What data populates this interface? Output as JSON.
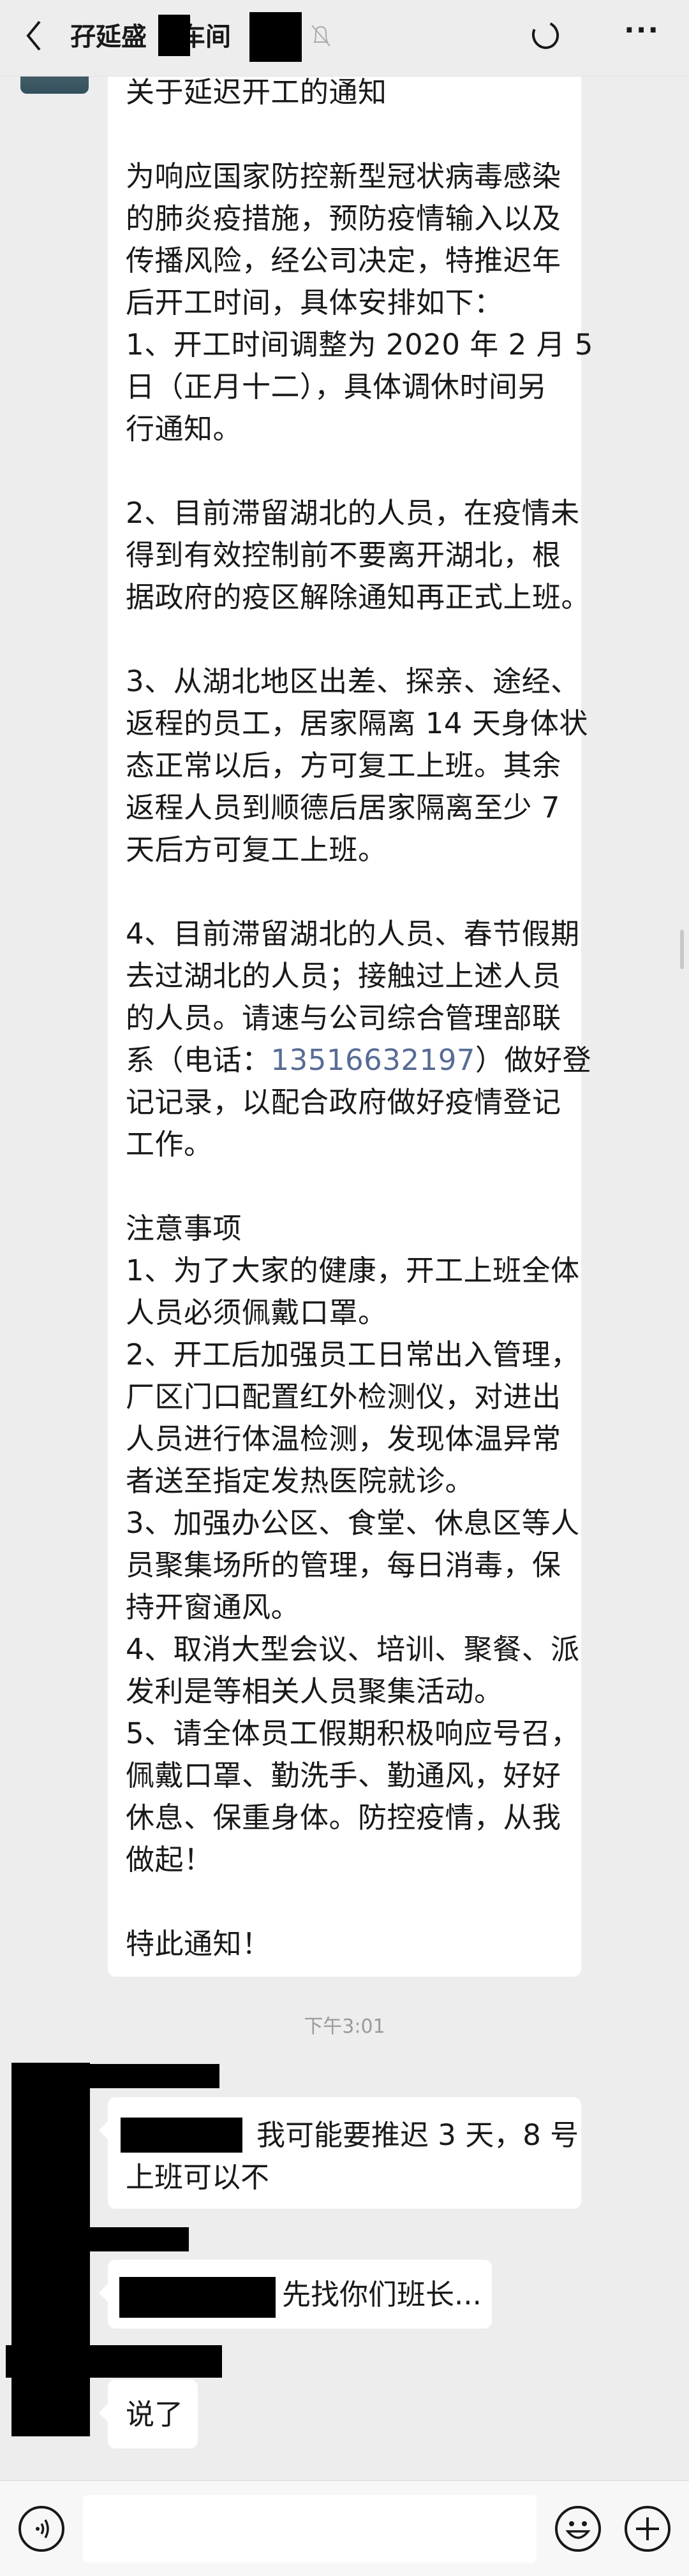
{
  "header": {
    "title_prefix": "孖延盛",
    "title_mid": "车间",
    "back_icon": "chevron-left-icon",
    "mute_icon": "bell-off-icon",
    "more": "···"
  },
  "notice": {
    "lines": [
      "关于延迟开工的通知",
      "",
      "为响应国家防控新型冠状病毒感染",
      "的肺炎疫措施，预防疫情输入以及",
      "传播风险，经公司决定，特推迟年",
      "后开工时间，具体安排如下：",
      "1、开工时间调整为 2020 年 2 月 5",
      "日（正月十二），具体调休时间另",
      "行通知。",
      "",
      "2、目前滞留湖北的人员，在疫情未",
      "得到有效控制前不要离开湖北，根",
      "据政府的疫区解除通知再正式上班。",
      "",
      "3、从湖北地区出差、探亲、途经、",
      "返程的员工，居家隔离 14 天身体状",
      "态正常以后，方可复工上班。其余",
      "返程人员到顺德后居家隔离至少 7",
      "天后方可复工上班。",
      "",
      "4、目前滞留湖北的人员、春节假期",
      "去过湖北的人员；接触过上述人员",
      "的人员。请速与公司综合管理部联",
      "PHONE",
      "记记录，以配合政府做好疫情登记",
      "工作。",
      "",
      "注意事项",
      "1、为了大家的健康，开工上班全体",
      "人员必须佩戴口罩。",
      "2、开工后加强员工日常出入管理，",
      "厂区门口配置红外检测仪，对进出",
      "人员进行体温检测，发现体温异常",
      "者送至指定发热医院就诊。",
      "3、加强办公区、食堂、休息区等人",
      "员聚集场所的管理，每日消毒，保",
      "持开窗通风。",
      "4、取消大型会议、培训、聚餐、派",
      "发利是等相关人员聚集活动。",
      "5、请全体员工假期积极响应号召，",
      "佩戴口罩、勤洗手、勤通风，好好",
      "休息、保重身体。防控疫情，从我",
      "做起！",
      "",
      "特此通知！"
    ],
    "phone_line": {
      "before": "系（电话：",
      "phone": "13516632197",
      "after": "）做好登"
    }
  },
  "timestamp": "下午3:01",
  "messages": [
    {
      "line1": "我可能要推迟 3 天，8 号",
      "line2": "上班可以不"
    },
    {
      "text": "先找你们班长..."
    },
    {
      "text": "说了"
    }
  ],
  "colors": {
    "link": "#576b95",
    "bg": "#ededed"
  }
}
